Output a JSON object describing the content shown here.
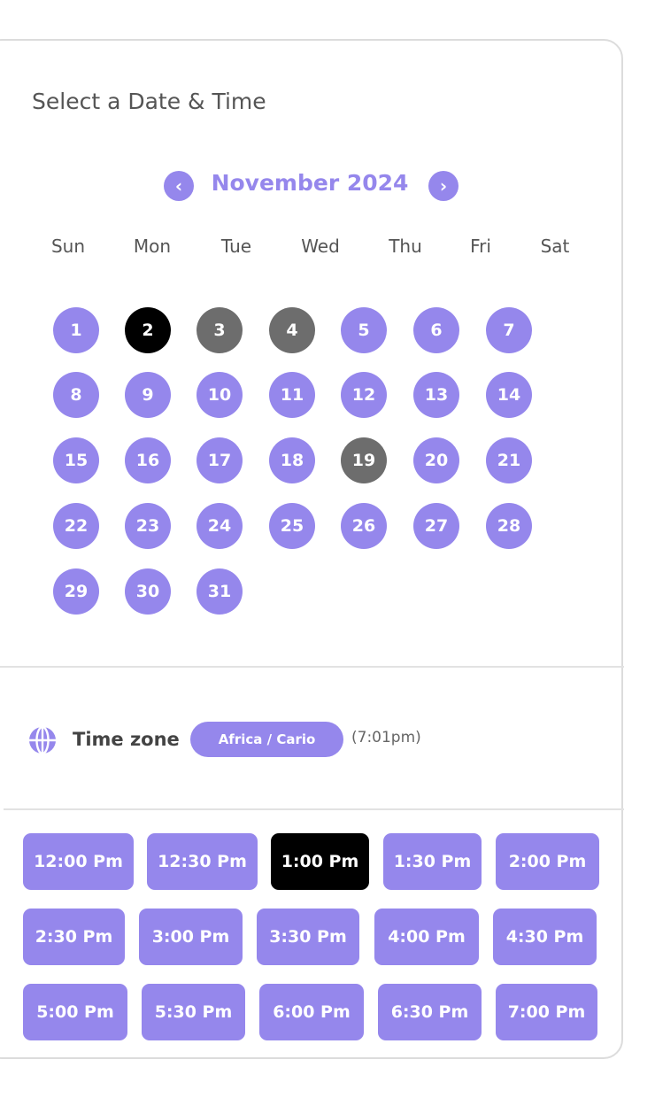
{
  "header": {
    "title": "Select a Date & Time"
  },
  "calendar": {
    "month": "November 2024",
    "prev_icon": "‹",
    "next_icon": "›",
    "weekdays": [
      "Sun",
      "Mon",
      "Tue",
      "Wed",
      "Thu",
      "Fri",
      "Sat"
    ],
    "days": [
      "1",
      "2",
      "3",
      "4",
      "5",
      "6",
      "7",
      "8",
      "9",
      "10",
      "11",
      "12",
      "13",
      "14",
      "15",
      "16",
      "17",
      "18",
      "19",
      "20",
      "21",
      "22",
      "23",
      "24",
      "25",
      "26",
      "27",
      "28",
      "29",
      "30",
      "31"
    ],
    "selected_day": "2",
    "disabled_days": [
      "3",
      "4",
      "19"
    ]
  },
  "timezone": {
    "label": "Time zone",
    "value": "Africa / Cario",
    "current_time": "(7:01pm)",
    "icon": "globe-icon"
  },
  "slots": [
    "12:00 Pm",
    "12:30 Pm",
    "1:00 Pm",
    "1:30 Pm",
    "2:00 Pm",
    "2:30 Pm",
    "3:00 Pm",
    "3:30 Pm",
    "4:00 Pm",
    "4:30 Pm",
    "5:00 Pm",
    "5:30 Pm",
    "6:00 Pm",
    "6:30 Pm",
    "7:00 Pm"
  ],
  "selected_slot": "1:00 Pm",
  "colors": {
    "accent": "#9587ec",
    "selected": "#000000",
    "disabled": "#6d6d6d",
    "text": "#555555"
  }
}
